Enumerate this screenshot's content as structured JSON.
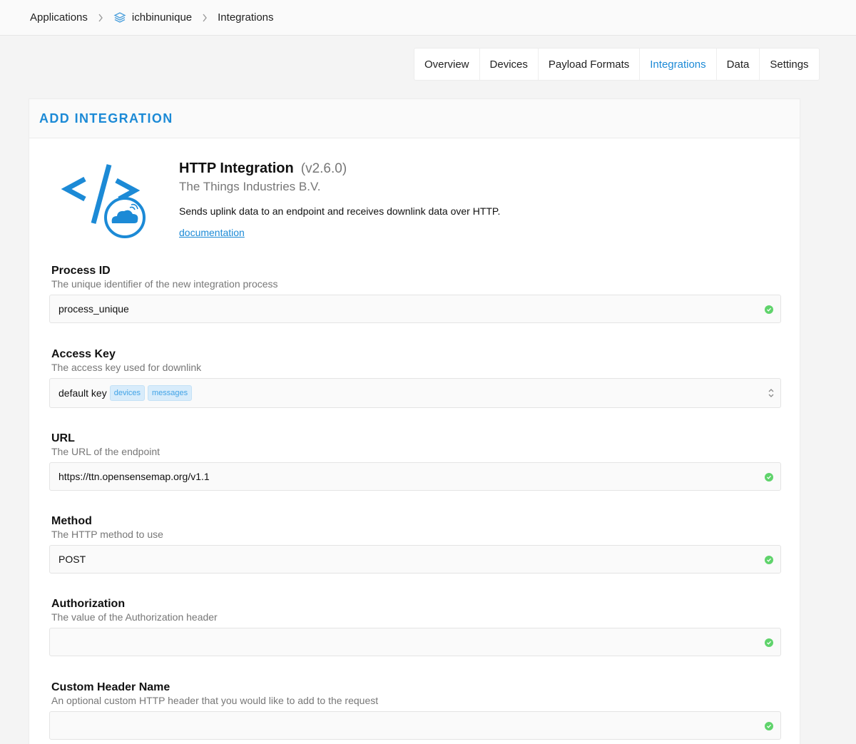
{
  "breadcrumb": {
    "items": [
      "Applications",
      "ichbinunique",
      "Integrations"
    ]
  },
  "tabs": [
    {
      "label": "Overview",
      "active": false
    },
    {
      "label": "Devices",
      "active": false
    },
    {
      "label": "Payload Formats",
      "active": false
    },
    {
      "label": "Integrations",
      "active": true
    },
    {
      "label": "Data",
      "active": false
    },
    {
      "label": "Settings",
      "active": false
    }
  ],
  "card": {
    "title": "ADD INTEGRATION"
  },
  "integration": {
    "name": "HTTP Integration",
    "version": "(v2.6.0)",
    "organization": "The Things Industries B.V.",
    "description": "Sends uplink data to an endpoint and receives downlink data over HTTP.",
    "documentation_link": "documentation"
  },
  "fields": {
    "process_id": {
      "label": "Process ID",
      "help": "The unique identifier of the new integration process",
      "value": "process_unique"
    },
    "access_key": {
      "label": "Access Key",
      "help": "The access key used for downlink",
      "value": "default key",
      "tags": [
        "devices",
        "messages"
      ]
    },
    "url": {
      "label": "URL",
      "help": "The URL of the endpoint",
      "value": "https://ttn.opensensemap.org/v1.1"
    },
    "method": {
      "label": "Method",
      "help": "The HTTP method to use",
      "value": "POST"
    },
    "authorization": {
      "label": "Authorization",
      "help": "The value of the Authorization header",
      "value": ""
    },
    "custom_header_name": {
      "label": "Custom Header Name",
      "help": "An optional custom HTTP header that you would like to add to the request",
      "value": ""
    }
  },
  "colors": {
    "accent": "#1c8ad6",
    "valid": "#5fd36b"
  },
  "icons": [
    "chevron-right-icon",
    "application-stack-icon",
    "http-integration-logo",
    "valid-check-icon",
    "select-arrows-icon"
  ]
}
